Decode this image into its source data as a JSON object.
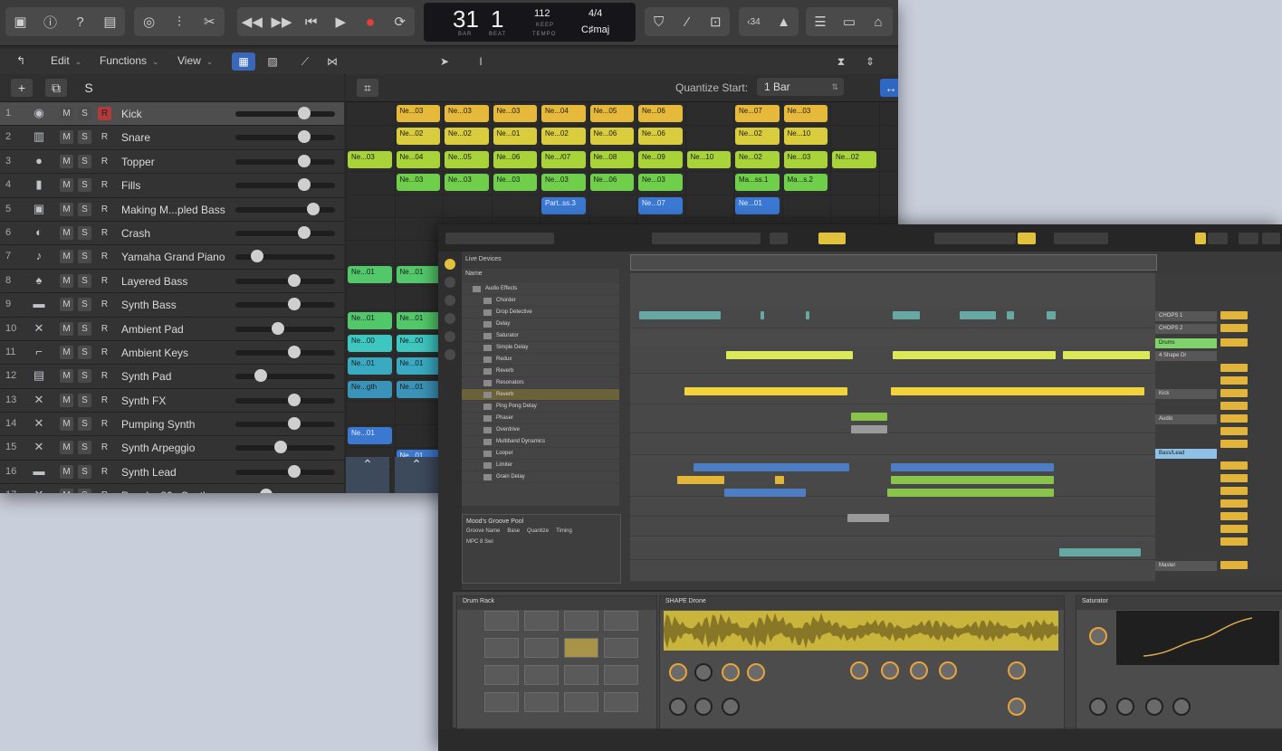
{
  "logic": {
    "lcd": {
      "bar": "31",
      "beat": "1",
      "bar_label": "BAR",
      "beat_label": "BEAT",
      "tempo": "112",
      "tempo_label": "KEEP",
      "tempo_sub": "TEMPO",
      "time_sig": "4/4",
      "key": "C♯maj"
    },
    "key_badge": "‹34",
    "menu": {
      "edit": "Edit",
      "functions": "Functions",
      "view": "View"
    },
    "quantize_label": "Quantize Start:",
    "quantize_value": "1 Bar",
    "tracks": [
      {
        "num": "1",
        "name": "Kick",
        "icon": "drum-machine-icon"
      },
      {
        "num": "2",
        "name": "Snare",
        "icon": "snare-icon"
      },
      {
        "num": "3",
        "name": "Topper",
        "icon": "drum-icon"
      },
      {
        "num": "4",
        "name": "Fills",
        "icon": "tambourine-icon"
      },
      {
        "num": "5",
        "name": "Making M...pled Bass",
        "icon": "sampler-icon"
      },
      {
        "num": "6",
        "name": "Crash",
        "icon": "cymbal-icon"
      },
      {
        "num": "7",
        "name": "Yamaha Grand Piano",
        "icon": "piano-icon"
      },
      {
        "num": "8",
        "name": "Layered Bass",
        "icon": "bass-icon"
      },
      {
        "num": "9",
        "name": "Synth Bass",
        "icon": "keyboard-icon"
      },
      {
        "num": "10",
        "name": "Ambient Pad",
        "icon": "synth-icon"
      },
      {
        "num": "11",
        "name": "Ambient Keys",
        "icon": "keys-icon"
      },
      {
        "num": "12",
        "name": "Synth Pad",
        "icon": "pad-icon"
      },
      {
        "num": "13",
        "name": "Synth FX",
        "icon": "fx-icon"
      },
      {
        "num": "14",
        "name": "Pumping Synth",
        "icon": "synth-icon"
      },
      {
        "num": "15",
        "name": "Synth Arpeggio",
        "icon": "synth-icon"
      },
      {
        "num": "16",
        "name": "Synth Lead",
        "icon": "keyboard-icon"
      },
      {
        "num": "17",
        "name": "Punchy 80s Synth",
        "icon": "synth-icon"
      }
    ],
    "m_label": "M",
    "s_label": "S",
    "r_label": "R",
    "regions": [
      {
        "label": "Ne...03"
      },
      {
        "label": "Ne...03"
      },
      {
        "label": "Ne...03"
      },
      {
        "label": "Ne...04"
      },
      {
        "label": "Ne...05"
      },
      {
        "label": "Ne...06"
      },
      {
        "label": "Ne...07"
      },
      {
        "label": "Ne...03"
      },
      {
        "label": "Ne...02"
      },
      {
        "label": "Ne...02"
      },
      {
        "label": "Ne...01"
      },
      {
        "label": "Ne...02"
      },
      {
        "label": "Ne...06"
      },
      {
        "label": "Ne...06"
      },
      {
        "label": "Ne...02"
      },
      {
        "label": "Ne...10"
      },
      {
        "label": "Ne...03"
      },
      {
        "label": "Ne...04"
      },
      {
        "label": "Ne...05"
      },
      {
        "label": "Ne...06"
      },
      {
        "label": "Ne.../07"
      },
      {
        "label": "Ne...08"
      },
      {
        "label": "Ne...09"
      },
      {
        "label": "Ne...10"
      },
      {
        "label": "Ne...02"
      },
      {
        "label": "Ne...03"
      },
      {
        "label": "Ne...02"
      },
      {
        "label": "Ne...03"
      },
      {
        "label": "Ne...03"
      },
      {
        "label": "Ne...03"
      },
      {
        "label": "Ne...03"
      },
      {
        "label": "Ne...06"
      },
      {
        "label": "Ne...03"
      },
      {
        "label": "Ma...ss.1"
      },
      {
        "label": "Ma...s.2"
      },
      {
        "label": "Part..ss.3"
      },
      {
        "label": "Ne...07"
      },
      {
        "label": "Ne...01"
      },
      {
        "label": "Ne...01"
      },
      {
        "label": "Ne...01"
      },
      {
        "label": "Ne...01"
      },
      {
        "label": "Ne...01"
      },
      {
        "label": "Ne...00"
      },
      {
        "label": "Ne...00"
      },
      {
        "label": "Ne...01"
      },
      {
        "label": "Ne...01"
      },
      {
        "label": "Ne...gth"
      },
      {
        "label": "Ne...01"
      }
    ]
  },
  "live": {
    "browser_title": "Live Devices",
    "browser_col": "Name",
    "browser_root": "Audio Effects",
    "browser_items": [
      "Chorder",
      "Drop Detective",
      "Delay",
      "Saturator",
      "Simple Delay",
      "Redux",
      "Reverb",
      "Resonators",
      "Reverb",
      "Ping Pong Delay",
      "Phaser",
      "Overdrive",
      "Multiband Dynamics",
      "Looper",
      "Limiter",
      "Grain Delay"
    ],
    "groove_title": "Mood's Groove Pool",
    "groove_cols": [
      "Groove Name",
      "Base",
      "Quantize",
      "Timing"
    ],
    "groove_row": "MPC 8 Swi",
    "mixer": {
      "chops1": "CHOPS 1",
      "chops2": "CHOPS 2",
      "drums": "Drums",
      "shape": "4 Shape Dr",
      "kick": "Kick",
      "audio": "Audio",
      "basslead": "Bass/Lead",
      "master": "Master"
    },
    "devices": {
      "drum_rack": "Drum Rack",
      "shape_drone": "SHAPE Drone",
      "saturator": "Saturator"
    }
  },
  "colors": {
    "logic_yellow": "#e6b93a",
    "logic_green": "#6fcf4a",
    "logic_blue": "#3a78d2",
    "live_yellow": "#e2c23c"
  }
}
